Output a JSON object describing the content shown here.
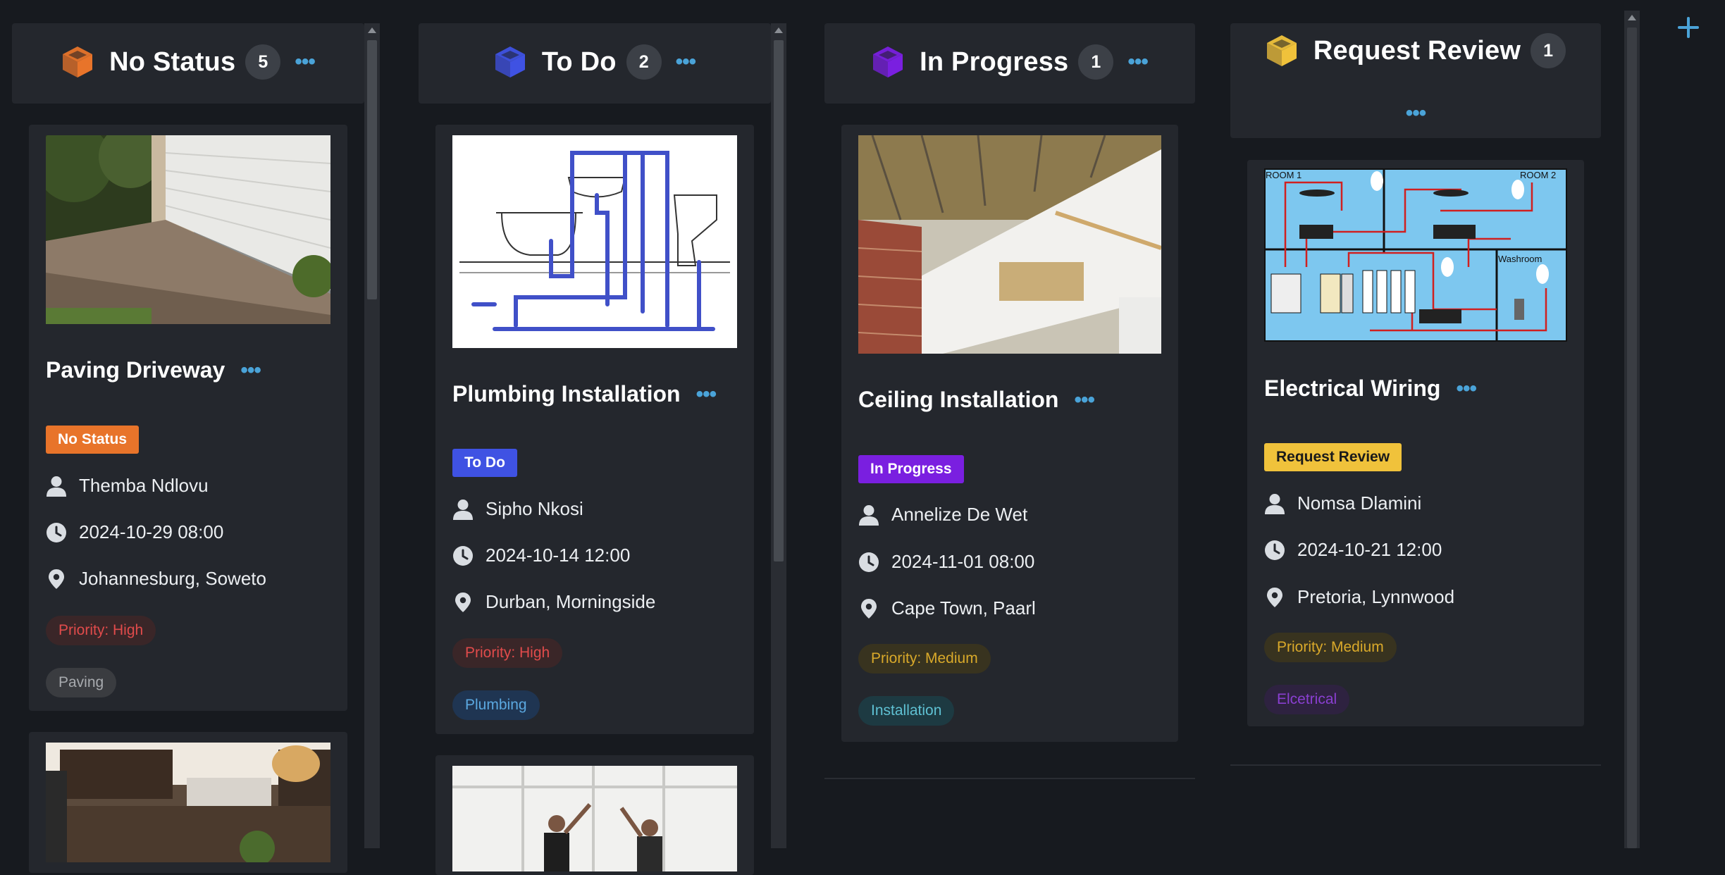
{
  "columns": [
    {
      "title": "No Status",
      "count": "5",
      "cube_color": "#e8742a"
    },
    {
      "title": "To Do",
      "count": "2",
      "cube_color": "#3f52e3"
    },
    {
      "title": "In Progress",
      "count": "1",
      "cube_color": "#7a1fe0"
    },
    {
      "title": "Request Review",
      "count": "1",
      "cube_color": "#f0c23b"
    }
  ],
  "cards": [
    {
      "title": "Paving Driveway",
      "status": "No Status",
      "status_color": "#e8742a",
      "assignee": "Themba Ndlovu",
      "datetime": "2024-10-29 08:00",
      "location": "Johannesburg, Soweto",
      "priority": "Priority: High",
      "category": "Paving"
    },
    {
      "title": "Plumbing Installation",
      "status": "To Do",
      "status_color": "#3f52e3",
      "assignee": "Sipho Nkosi",
      "datetime": "2024-10-14 12:00",
      "location": "Durban, Morningside",
      "priority": "Priority: High",
      "category": "Plumbing"
    },
    {
      "title": "Ceiling Installation",
      "status": "In Progress",
      "status_color": "#7a1fe0",
      "assignee": "Annelize De Wet",
      "datetime": "2024-11-01 08:00",
      "location": "Cape Town, Paarl",
      "priority": "Priority: Medium",
      "category": "Installation"
    },
    {
      "title": "Electrical Wiring",
      "status": "Request Review",
      "status_color": "#f0c23b",
      "assignee": "Nomsa Dlamini",
      "datetime": "2024-10-21 12:00",
      "location": "Pretoria, Lynnwood",
      "priority": "Priority: Medium",
      "category": "Elcetrical"
    }
  ],
  "diagram_labels": {
    "room1": "ROOM 1",
    "room2": "ROOM 2",
    "washroom": "Washroom"
  },
  "icons": {
    "column": "cube-icon",
    "menu": "more-dots-icon",
    "assignee": "person-icon",
    "date": "clock-icon",
    "location": "map-pin-icon",
    "add": "plus-icon"
  },
  "colors": {
    "background": "#171a1f",
    "panel": "#24272d",
    "accent": "#4aa3d8"
  }
}
